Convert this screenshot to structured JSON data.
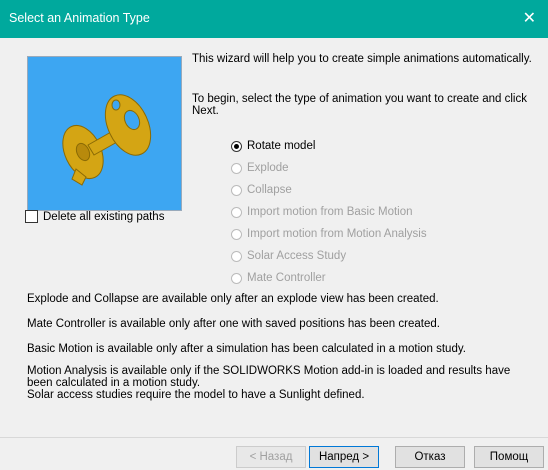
{
  "window": {
    "title": "Select an Animation Type",
    "close_glyph": "✕"
  },
  "intro": {
    "line1": "This wizard will help you to create simple animations automatically.",
    "line2": "To begin, select the type of animation you want to create and click Next."
  },
  "delete_paths": {
    "label": "Delete all existing paths",
    "checked": false
  },
  "animation_types": [
    {
      "label": "Rotate model",
      "selected": true,
      "enabled": true
    },
    {
      "label": "Explode",
      "selected": false,
      "enabled": false
    },
    {
      "label": "Collapse",
      "selected": false,
      "enabled": false
    },
    {
      "label": "Import motion from Basic Motion",
      "selected": false,
      "enabled": false
    },
    {
      "label": "Import motion from Motion Analysis",
      "selected": false,
      "enabled": false
    },
    {
      "label": "Solar Access Study",
      "selected": false,
      "enabled": false
    },
    {
      "label": "Mate Controller",
      "selected": false,
      "enabled": false
    }
  ],
  "notes": {
    "explode": "Explode and Collapse are available only after an explode view has been created.",
    "mate": "Mate Controller is available only after one with saved positions has been created.",
    "basic": "Basic Motion is available only after a simulation has been calculated in a motion study.",
    "motion_analysis": "Motion Analysis is available only if the SOLIDWORKS Motion add-in is loaded and results have been calculated in a motion study.",
    "solar": "Solar access studies require the model to have a Sunlight defined."
  },
  "buttons": {
    "back": "< Назад",
    "next": "Напред >",
    "cancel": "Отказ",
    "help": "Помощ"
  },
  "colors": {
    "titlebar": "#00a99d",
    "preview_bg": "#3da6f2",
    "model": "#d4a514"
  }
}
